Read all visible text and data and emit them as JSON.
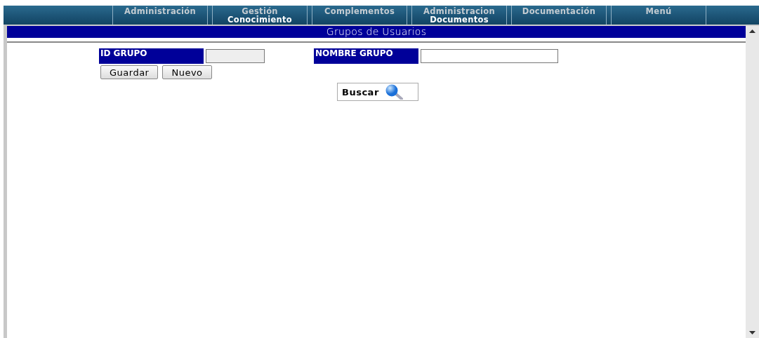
{
  "menu": [
    {
      "lines": [
        "Administración"
      ]
    },
    {
      "lines": [
        "Gestión",
        "Conocimiento"
      ]
    },
    {
      "lines": [
        "Complementos"
      ]
    },
    {
      "lines": [
        "Administracion",
        "Documentos"
      ]
    },
    {
      "lines": [
        "Documentación"
      ]
    },
    {
      "lines": [
        "Menú"
      ]
    }
  ],
  "panel": {
    "title": "Grupos de Usuarios",
    "fields": [
      {
        "label": "ID GRUPO",
        "disabled": true
      },
      {
        "label": "NOMBRE GRUPO",
        "disabled": false
      }
    ],
    "buttons": [
      "Guardar",
      "Nuevo"
    ],
    "search_button": "Buscar"
  }
}
